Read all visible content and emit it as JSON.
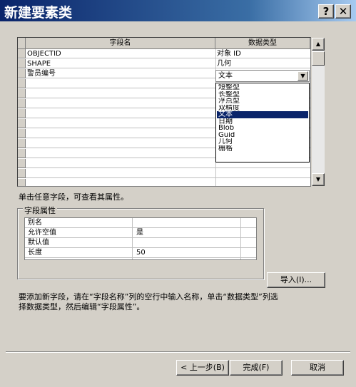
{
  "window": {
    "title": "新建要素类",
    "help_btn": "?",
    "close_btn": "✕"
  },
  "grid": {
    "col_field_name": "字段名",
    "col_data_type": "数据类型",
    "rows": [
      {
        "name": "OBJECTID",
        "type": "对象 ID"
      },
      {
        "name": "SHAPE",
        "type": "几何"
      },
      {
        "name": "警员编号",
        "type": "文本"
      }
    ]
  },
  "dropdown": {
    "selected": "文本",
    "options": [
      "短整型",
      "长整型",
      "浮点型",
      "双精度",
      "文本",
      "日期",
      "Blob",
      "Guid",
      "几何",
      "栅格"
    ],
    "highlighted_index": 4
  },
  "hint1": "单击任意字段，可查看其属性。",
  "field_props": {
    "group_label": "字段属性",
    "rows": [
      {
        "label": "别名",
        "value": ""
      },
      {
        "label": "允许空值",
        "value": "是"
      },
      {
        "label": "默认值",
        "value": ""
      },
      {
        "label": "长度",
        "value": "50"
      }
    ]
  },
  "import_btn": "导入(I)...",
  "hint2_line1": "要添加新字段，请在“字段名称”列的空行中输入名称，单击“数据类型”列选",
  "hint2_line2": "择数据类型，然后编辑“字段属性”。",
  "buttons": {
    "back": "< 上一步(B)",
    "finish": "完成(F)",
    "cancel": "取消"
  }
}
